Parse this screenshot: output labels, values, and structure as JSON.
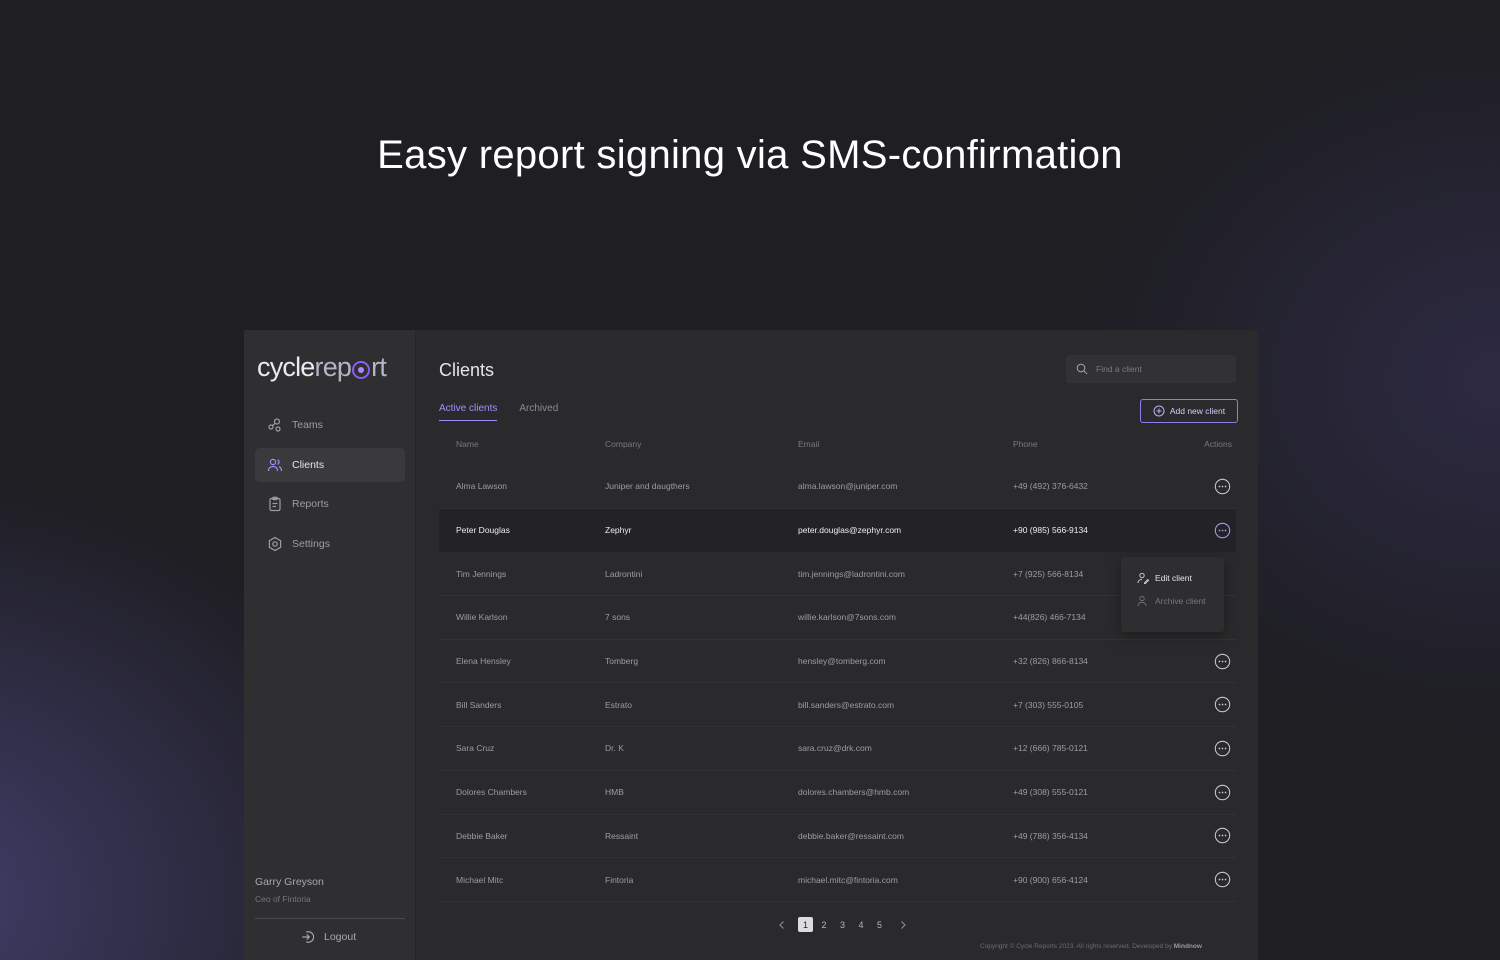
{
  "hero": {
    "title": "Easy report signing via SMS-confirmation"
  },
  "brand": {
    "logo_part1": "cycle",
    "logo_part2": "rep",
    "logo_part3": "rt",
    "accent": "#8b5cf6"
  },
  "sidebar": {
    "items": [
      {
        "label": "Teams",
        "icon": "teams-icon",
        "active": false
      },
      {
        "label": "Clients",
        "icon": "clients-icon",
        "active": true
      },
      {
        "label": "Reports",
        "icon": "reports-icon",
        "active": false
      },
      {
        "label": "Settings",
        "icon": "settings-icon",
        "active": false
      }
    ],
    "user": {
      "name": "Garry Greyson",
      "role": "Ceo of Fintoria"
    },
    "logout_label": "Logout"
  },
  "main": {
    "title": "Clients",
    "search": {
      "placeholder": "Find a client"
    },
    "tabs": [
      {
        "label": "Active clients",
        "active": true
      },
      {
        "label": "Archived",
        "active": false
      }
    ],
    "add_button": "Add new client",
    "table": {
      "headers": {
        "name": "Name",
        "company": "Company",
        "email": "Email",
        "phone": "Phone",
        "actions": "Actions"
      },
      "rows": [
        {
          "name": "Alma Lawson",
          "company": "Juniper and daugthers",
          "email": "alma.lawson@juniper.com",
          "phone": "+49 (492) 376-6432"
        },
        {
          "name": "Peter Douglas",
          "company": "Zephyr",
          "email": "peter.douglas@zephyr.com",
          "phone": "+90 (985) 566-9134"
        },
        {
          "name": "Tim Jennings",
          "company": "Ladrontini",
          "email": "tim.jennings@ladrontini.com",
          "phone": "+7 (925) 566-8134"
        },
        {
          "name": "Willie Karlson",
          "company": "7 sons",
          "email": "willie.karlson@7sons.com",
          "phone": "+44(826) 466-7134"
        },
        {
          "name": "Elena Hensley",
          "company": "Tomberg",
          "email": "hensley@tomberg.com",
          "phone": "+32 (826) 866-8134"
        },
        {
          "name": "Bill Sanders",
          "company": "Estrato",
          "email": "bill.sanders@estrato.com",
          "phone": "+7 (303) 555-0105"
        },
        {
          "name": "Sara Cruz",
          "company": "Dr. K",
          "email": "sara.cruz@drk.com",
          "phone": "+12 (666) 785-0121"
        },
        {
          "name": "Dolores Chambers",
          "company": "HMB",
          "email": "dolores.chambers@hmb.com",
          "phone": "+49 (308) 555-0121"
        },
        {
          "name": "Debbie Baker",
          "company": "Ressaint",
          "email": "debbie.baker@ressaint.com",
          "phone": "+49 (786) 356-4134"
        },
        {
          "name": "Michael Mitc",
          "company": "Fintoria",
          "email": "michael.mitc@fintoria.com",
          "phone": "+90 (900) 656-4124"
        }
      ]
    },
    "context_menu": {
      "edit": "Edit client",
      "archive": "Archive client"
    },
    "pagination": {
      "pages": [
        "1",
        "2",
        "3",
        "4",
        "5"
      ],
      "current": "1"
    },
    "footer": {
      "copyright": "Copyright © Cycle Reports 2023. All rights reserved.",
      "developed_by": "Developed by",
      "developer": "Mindnow"
    }
  }
}
